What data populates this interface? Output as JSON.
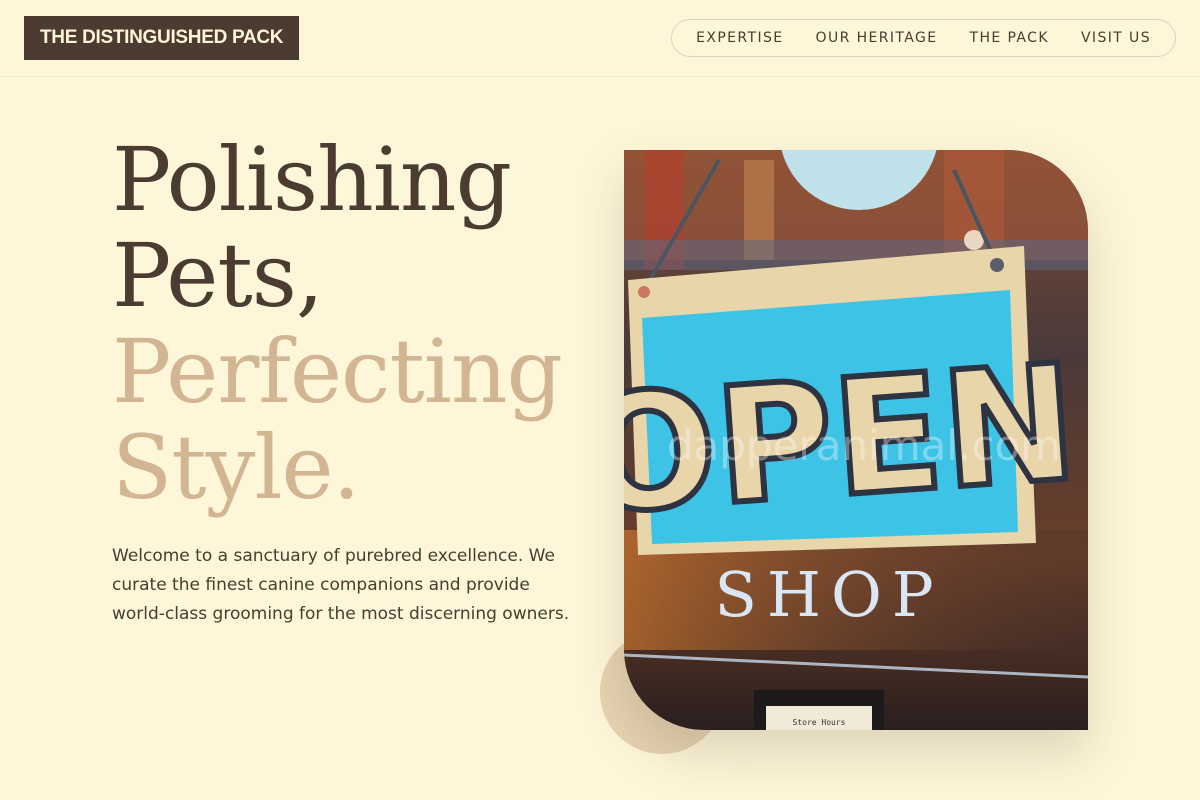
{
  "header": {
    "brand": "THE DISTINGUISHED PACK",
    "nav": [
      {
        "label": "EXPERTISE"
      },
      {
        "label": "OUR HERITAGE"
      },
      {
        "label": "THE PACK"
      },
      {
        "label": "VISIT US"
      }
    ]
  },
  "hero": {
    "headline_dark": [
      "Polishing",
      "Pets,"
    ],
    "headline_accent": [
      "Perfecting",
      "Style."
    ],
    "intro": "Welcome to a sanctuary of purebred excellence. We curate the finest canine companions and provide world-class grooming for the most discerning owners."
  },
  "photo": {
    "sign_text": "OPEN",
    "window_text": "SHOP",
    "watermark": "dapperanimal.com",
    "small_sign": "Store Hours"
  },
  "colors": {
    "background": "#fef6d8",
    "brand_dark": "#4b3b30",
    "accent": "#d2b592"
  }
}
